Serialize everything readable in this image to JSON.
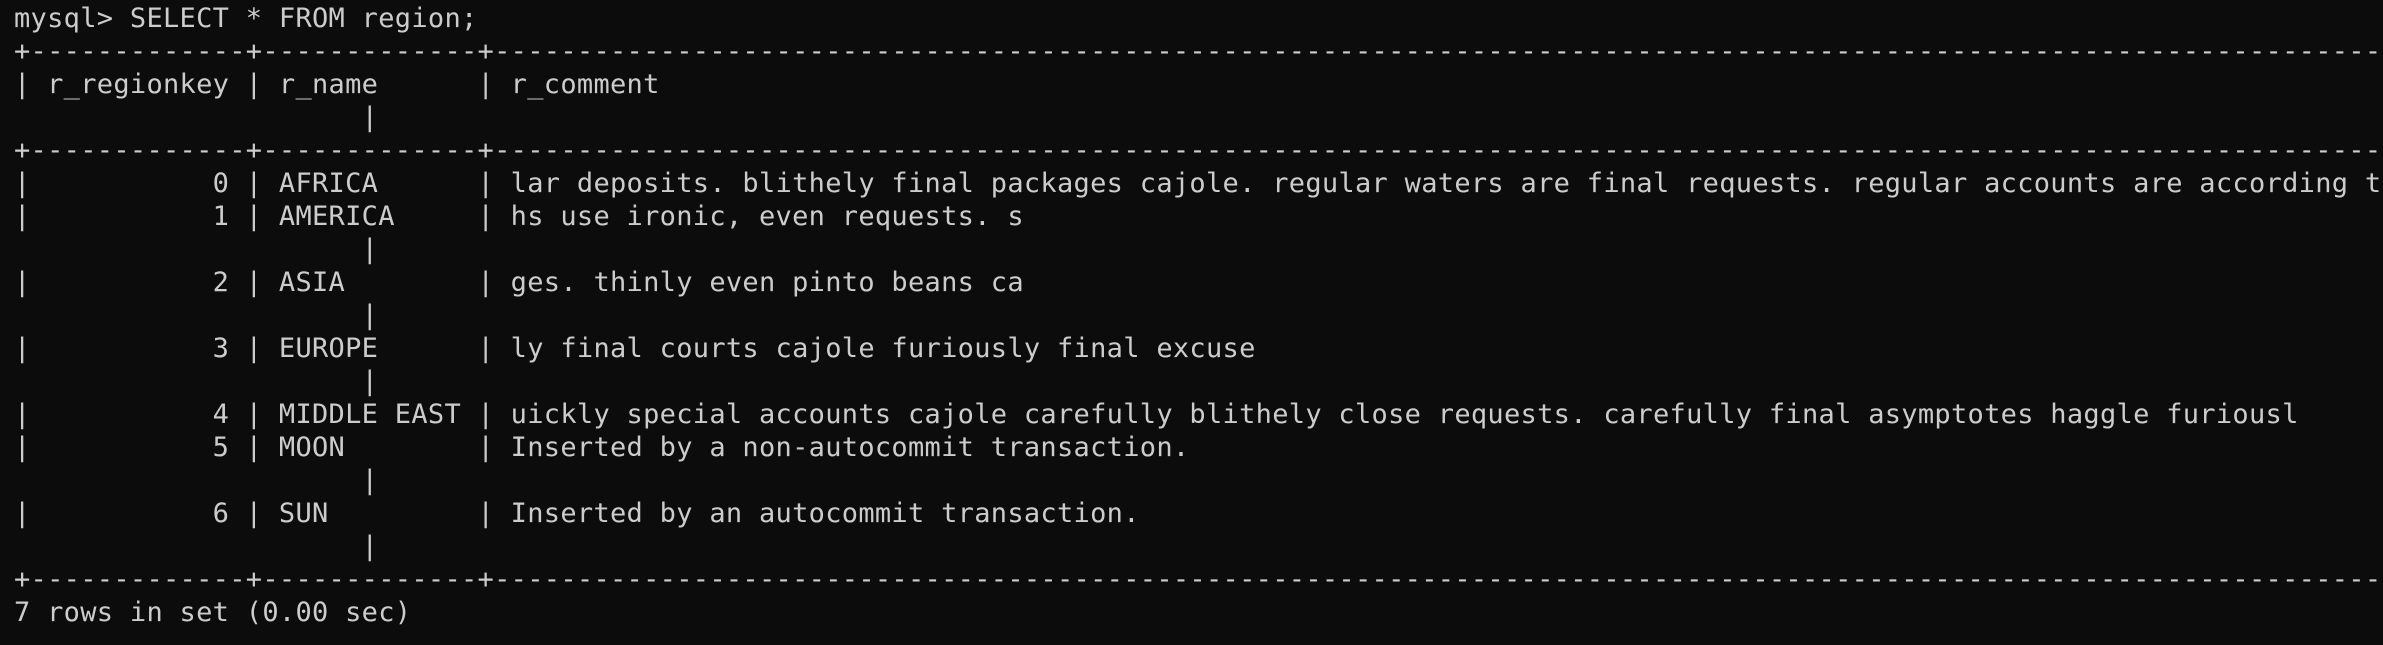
{
  "terminal": {
    "lines": [
      "mysql> SELECT * FROM region;",
      "+-------------+-------------+------------------------------------------------------------------------------------------------------------------------+",
      "| r_regionkey | r_name      | r_comment",
      "                     |",
      "+-------------+-------------+------------------------------------------------------------------------------------------------------------------------+",
      "|           0 | AFRICA      | lar deposits. blithely final packages cajole. regular waters are final requests. regular accounts are according to  |",
      "|           1 | AMERICA     | hs use ironic, even requests. s",
      "                     |",
      "|           2 | ASIA        | ges. thinly even pinto beans ca",
      "                     |",
      "|           3 | EUROPE      | ly final courts cajole furiously final excuse",
      "                     |",
      "|           4 | MIDDLE EAST | uickly special accounts cajole carefully blithely close requests. carefully final asymptotes haggle furiousl        |",
      "|           5 | MOON        | Inserted by a non-autocommit transaction.",
      "                     |",
      "|           6 | SUN         | Inserted by an autocommit transaction.",
      "                     |",
      "+-------------+-------------+------------------------------------------------------------------------------------------------------------------------+",
      "7 rows in set (0.00 sec)"
    ]
  }
}
